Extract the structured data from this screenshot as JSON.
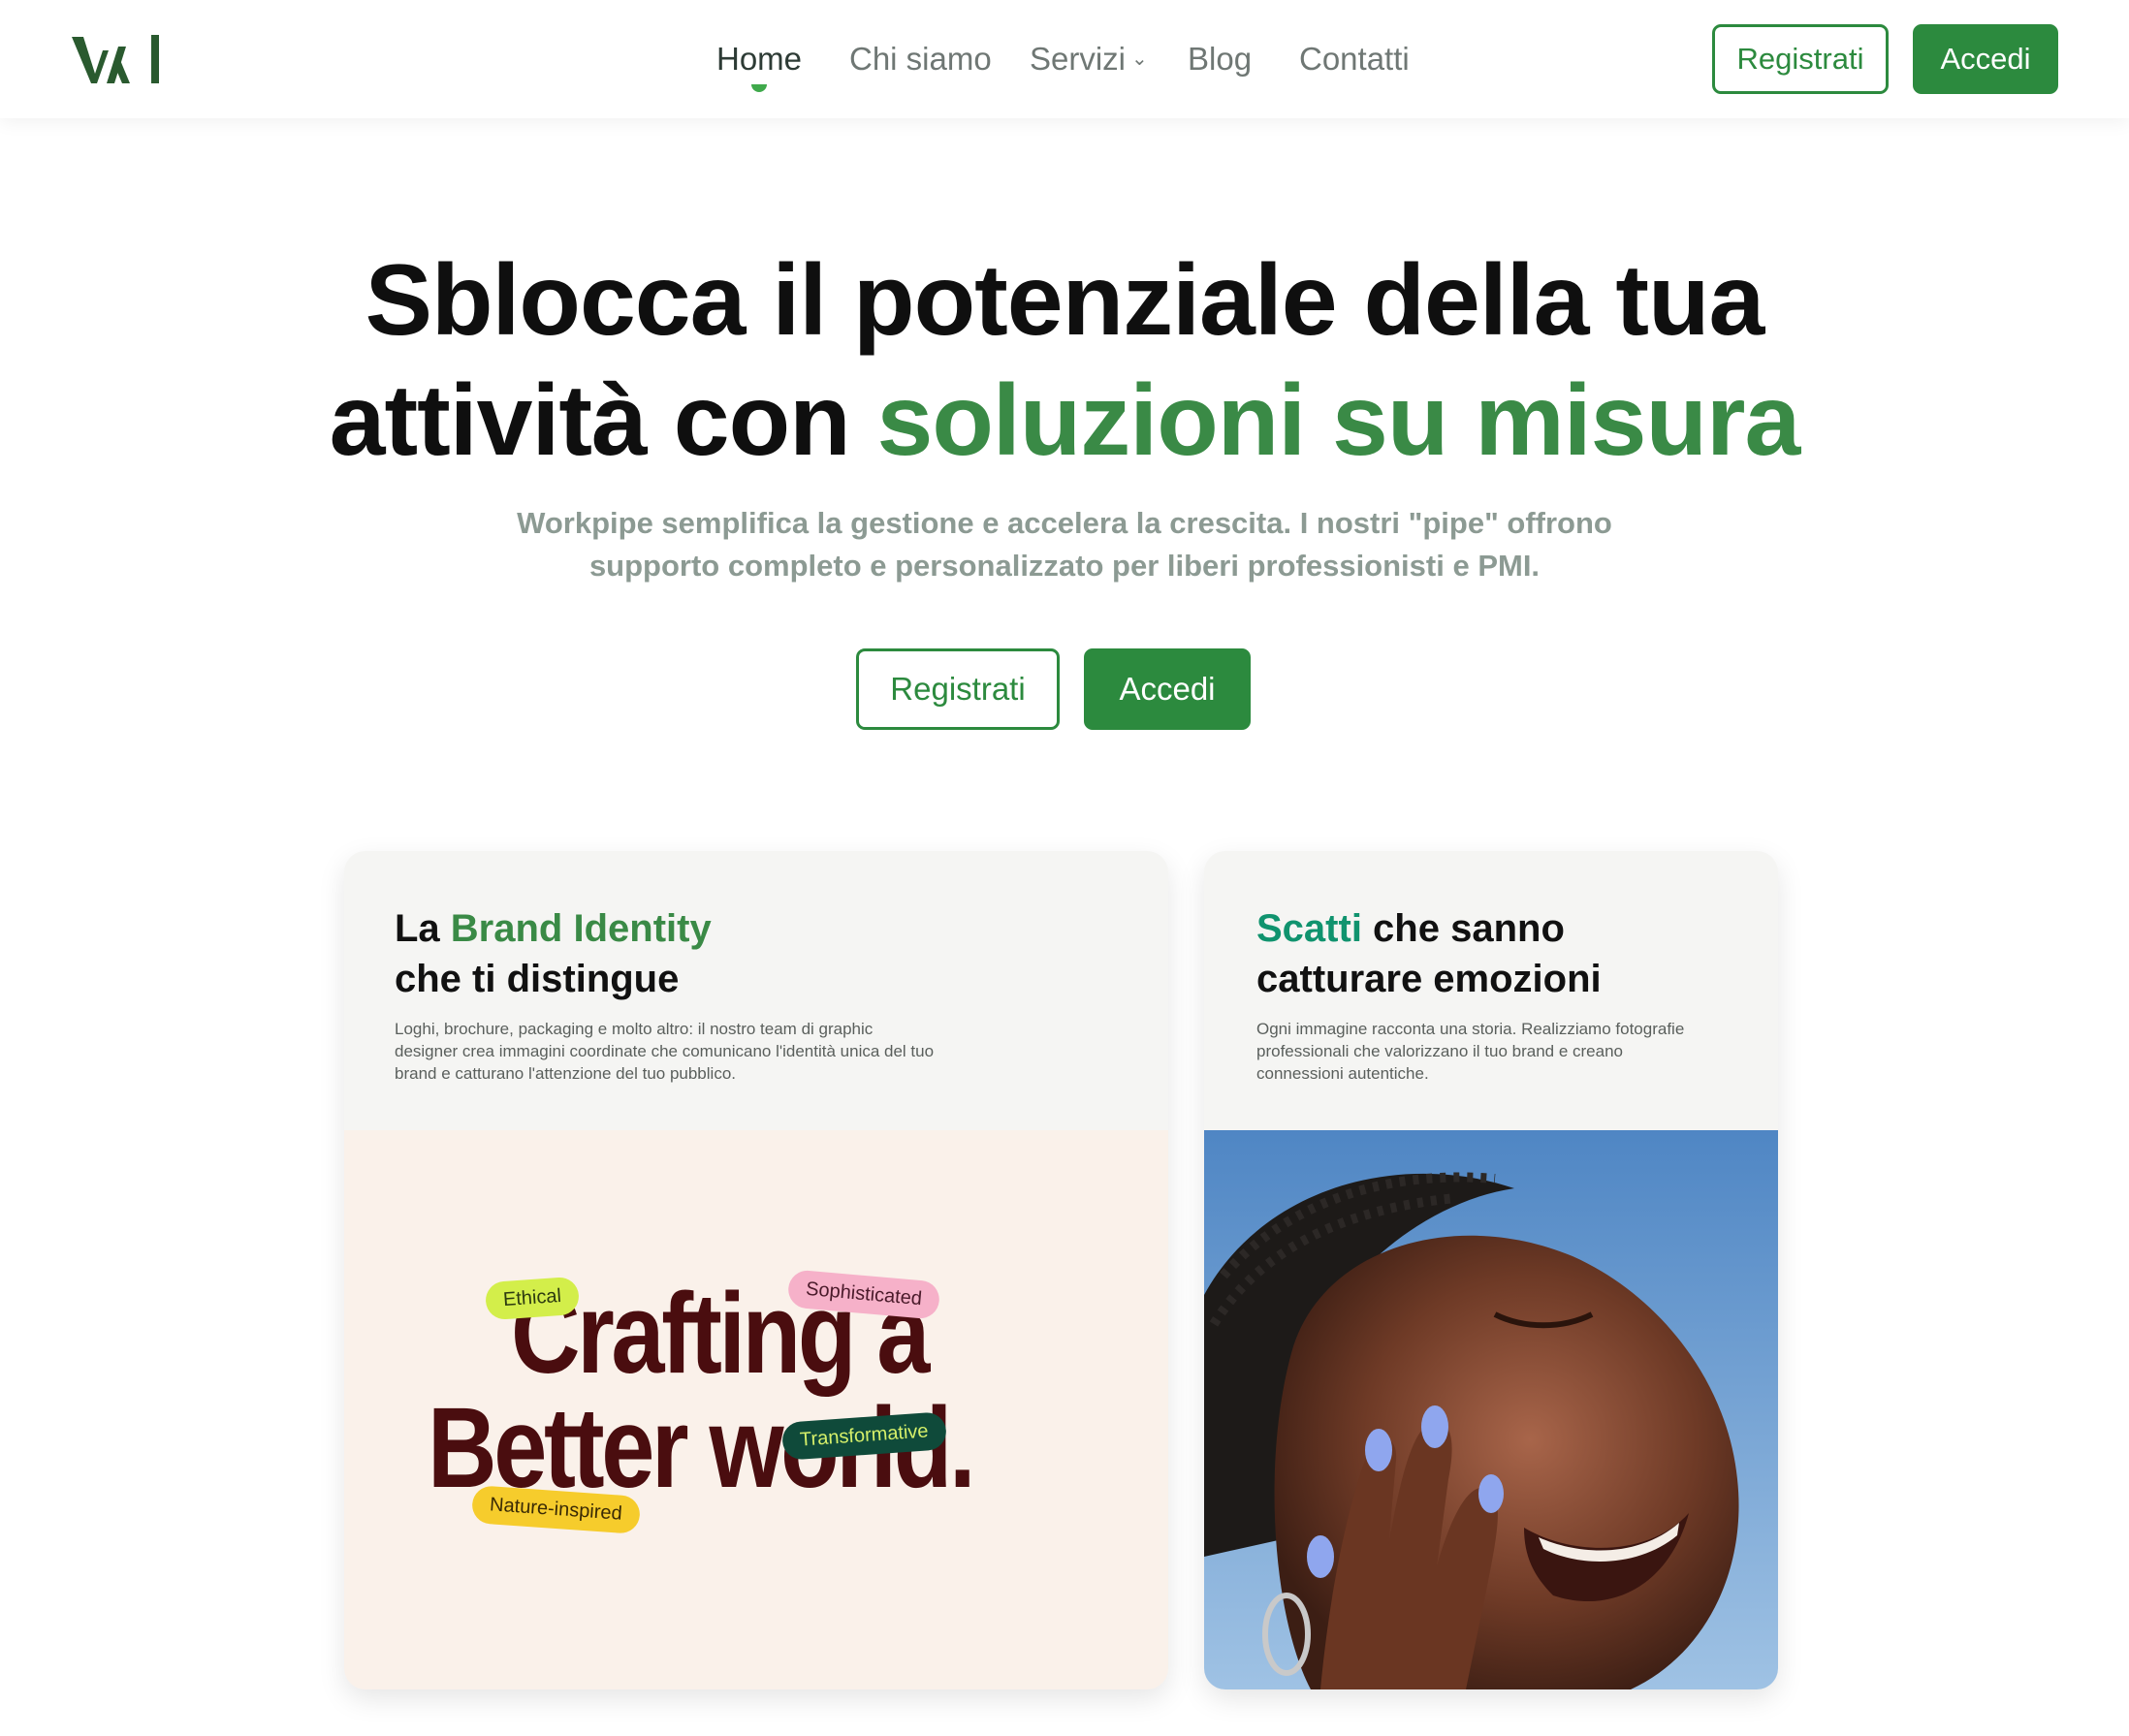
{
  "header": {
    "logo_icon": "workpipe-logo-icon",
    "nav": [
      {
        "label": "Home",
        "active": true
      },
      {
        "label": "Chi siamo"
      },
      {
        "label": "Servizi"
      },
      {
        "label": "Blog"
      },
      {
        "label": "Contatti"
      }
    ],
    "dropdown_icon": "chevron-down-icon",
    "register_label": "Registrati",
    "login_label": "Accedi"
  },
  "hero": {
    "title_part1": "Sblocca il potenziale della tua",
    "title_part2": "attività con ",
    "title_highlight": "soluzioni su misura",
    "subtitle_line1": "Workpipe semplifica la gestione e accelera la crescita. I nostri \"pipe\" offrono",
    "subtitle_line2": "supporto completo e personalizzato per liberi professionisti e PMI.",
    "register_label": "Registrati",
    "login_label": "Accedi"
  },
  "cards": {
    "brand": {
      "title_prefix": "La ",
      "title_highlight": "Brand Identity",
      "title_line2": "che ti distingue",
      "desc_line1": "Loghi, brochure, packaging e molto altro: il nostro team di graphic",
      "desc_line2": "designer crea immagini coordinate che comunicano l'identità unica del tuo",
      "desc_line3": "brand e catturano l'attenzione del tuo pubblico.",
      "image_line1": "Crafting a",
      "image_line2": "Better world.",
      "tags": [
        "Ethical",
        "Sophisticated",
        "Transformative",
        "Nature-inspired"
      ]
    },
    "photo": {
      "title_highlight": "Scatti",
      "title_suffix": " che sanno",
      "title_line2": "catturare emozioni",
      "desc_line1": "Ogni immagine racconta una storia. Realizziamo fotografie",
      "desc_line2": "professionali che valorizzano il tuo brand e creano",
      "desc_line3": "connessioni autentiche."
    }
  },
  "colors": {
    "accent": "#2c8a3e",
    "highlight": "#3a8a46",
    "teal": "#10936e",
    "brand_text": "#4a0d0f"
  }
}
